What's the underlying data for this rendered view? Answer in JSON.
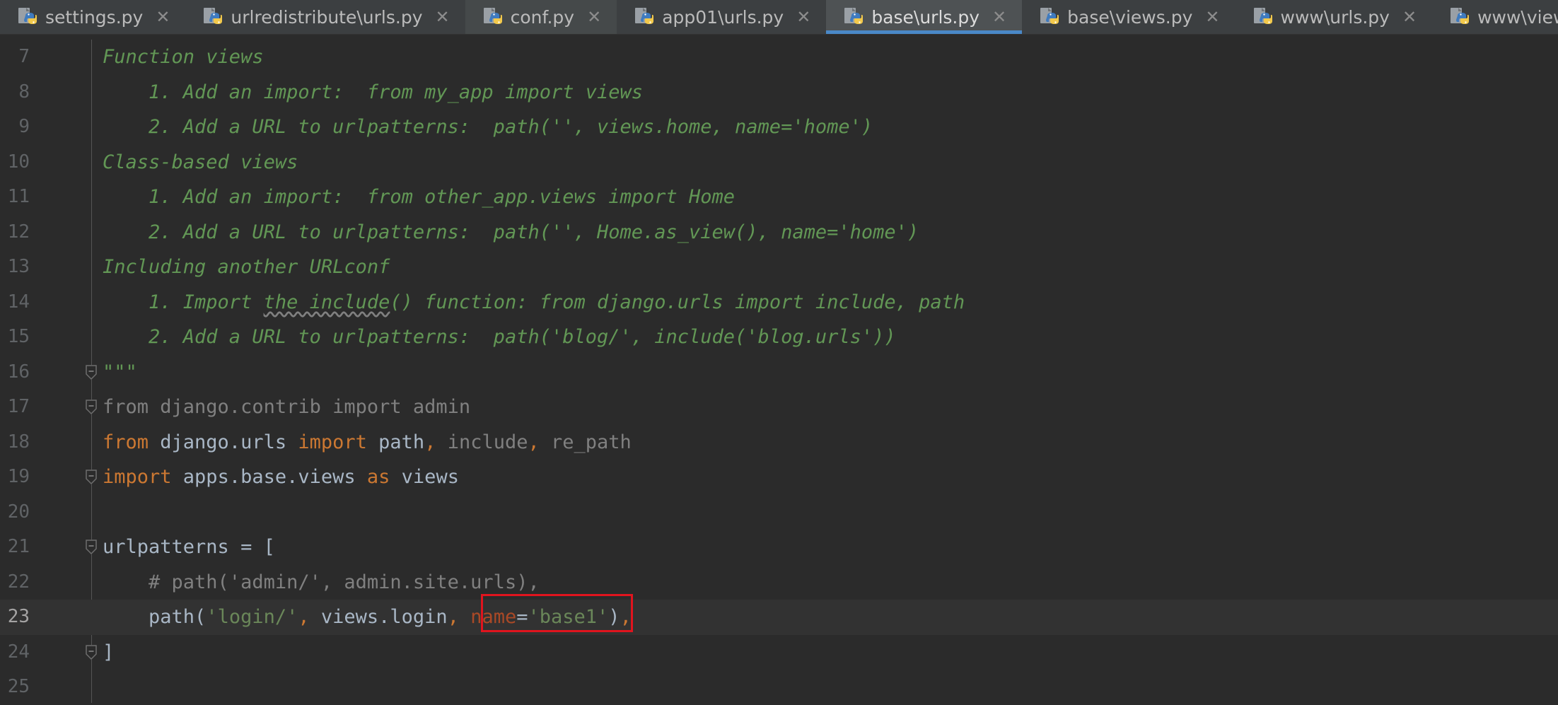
{
  "tabs": [
    {
      "label": "settings.py",
      "active": false
    },
    {
      "label": "urlredistribute\\urls.py",
      "active": false
    },
    {
      "label": "conf.py",
      "active": false
    },
    {
      "label": "app01\\urls.py",
      "active": false
    },
    {
      "label": "base\\urls.py",
      "active": true
    },
    {
      "label": "base\\views.py",
      "active": false
    },
    {
      "label": "www\\urls.py",
      "active": false
    },
    {
      "label": "www\\views.py",
      "active": false
    }
  ],
  "close_glyph": "✕",
  "accent_color": "#4a88c7",
  "highlight_color": "#e0141e",
  "current_line": 23,
  "lines": [
    {
      "n": "7",
      "tokens": [
        [
          "doc",
          "Function views"
        ]
      ]
    },
    {
      "n": "8",
      "tokens": [
        [
          "doc",
          "    1. Add an import:  from my_app import views"
        ]
      ]
    },
    {
      "n": "9",
      "tokens": [
        [
          "doc",
          "    2. Add a URL to urlpatterns:  path('', views.home, name='home')"
        ]
      ]
    },
    {
      "n": "10",
      "tokens": [
        [
          "doc",
          "Class-based views"
        ]
      ]
    },
    {
      "n": "11",
      "tokens": [
        [
          "doc",
          "    1. Add an import:  from other_app.views import Home"
        ]
      ]
    },
    {
      "n": "12",
      "tokens": [
        [
          "doc",
          "    2. Add a URL to urlpatterns:  path('', Home.as_view(), name='home')"
        ]
      ]
    },
    {
      "n": "13",
      "tokens": [
        [
          "doc",
          "Including another URLconf"
        ]
      ]
    },
    {
      "n": "14",
      "tokens": [
        [
          "doc",
          "    1. Import "
        ],
        [
          "doc wavy",
          "the include"
        ],
        [
          "doc",
          "() function: from django.urls import include, path"
        ]
      ]
    },
    {
      "n": "15",
      "tokens": [
        [
          "doc",
          "    2. Add a URL to urlpatterns:  path('blog/', include('blog.urls'))"
        ]
      ]
    },
    {
      "n": "16",
      "tokens": [
        [
          "doc",
          "\"\"\""
        ]
      ],
      "fold": true
    },
    {
      "n": "17",
      "tokens": [
        [
          "dim",
          "from django.contrib import admin"
        ]
      ],
      "fold": true
    },
    {
      "n": "18",
      "tokens": [
        [
          "kw",
          "from "
        ],
        [
          "plain",
          "django.urls "
        ],
        [
          "kw",
          "import "
        ],
        [
          "plain",
          "path"
        ],
        [
          "kw",
          ", "
        ],
        [
          "dim",
          "include"
        ],
        [
          "kw",
          ", "
        ],
        [
          "dim",
          "re_path"
        ]
      ]
    },
    {
      "n": "19",
      "tokens": [
        [
          "kw",
          "import "
        ],
        [
          "plain",
          "apps.base.views "
        ],
        [
          "kw",
          "as "
        ],
        [
          "plain",
          "views"
        ]
      ],
      "fold": true
    },
    {
      "n": "20",
      "tokens": []
    },
    {
      "n": "21",
      "tokens": [
        [
          "plain",
          "urlpatterns = ["
        ]
      ],
      "fold": true
    },
    {
      "n": "22",
      "tokens": [
        [
          "cmt",
          "    # path('admin/', admin.site.urls),"
        ]
      ]
    },
    {
      "n": "23",
      "tokens": [
        [
          "plain",
          "    path("
        ],
        [
          "str",
          "'login/'"
        ],
        [
          "kw",
          ", "
        ],
        [
          "plain",
          "views.login"
        ],
        [
          "kw",
          ", "
        ],
        [
          "named",
          "name"
        ],
        [
          "plain",
          "="
        ],
        [
          "str",
          "'base1'"
        ],
        [
          "plain",
          ")"
        ],
        [
          "kw",
          ","
        ]
      ]
    },
    {
      "n": "24",
      "tokens": [
        [
          "plain",
          "]"
        ]
      ],
      "fold": true
    },
    {
      "n": "25",
      "tokens": []
    }
  ]
}
